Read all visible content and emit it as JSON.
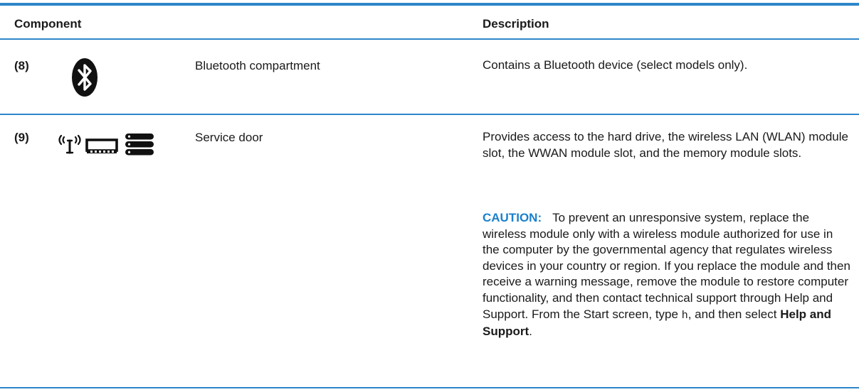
{
  "table": {
    "header": {
      "component": "Component",
      "description": "Description"
    },
    "rows": [
      {
        "number": "(8)",
        "icon": "bluetooth-icon",
        "name": "Bluetooth compartment",
        "description": "Contains a Bluetooth device (select models only)."
      },
      {
        "number": "(9)",
        "icons": [
          "wireless-icon",
          "memory-module-icon",
          "hard-drive-icon"
        ],
        "name": "Service door",
        "description": "Provides access to the hard drive, the wireless LAN (WLAN) module slot, the WWAN module slot, and the memory module slots.",
        "caution": {
          "label": "CAUTION:",
          "text": "To prevent an unresponsive system, replace the wireless module only with a wireless module authorized for use in the computer by the governmental agency that regulates wireless devices in your country or region. If you replace the module and then receive a warning message, remove the module to restore computer functionality, and then contact technical support through Help and Support. From the Start screen, type",
          "typed": "h",
          "after_typed": ", and then select",
          "link": "Help and Support",
          "end": "."
        }
      }
    ]
  },
  "colors": {
    "rule": "#2e86c9",
    "caution": "#1a80cc",
    "text": "#1a1a1a"
  }
}
